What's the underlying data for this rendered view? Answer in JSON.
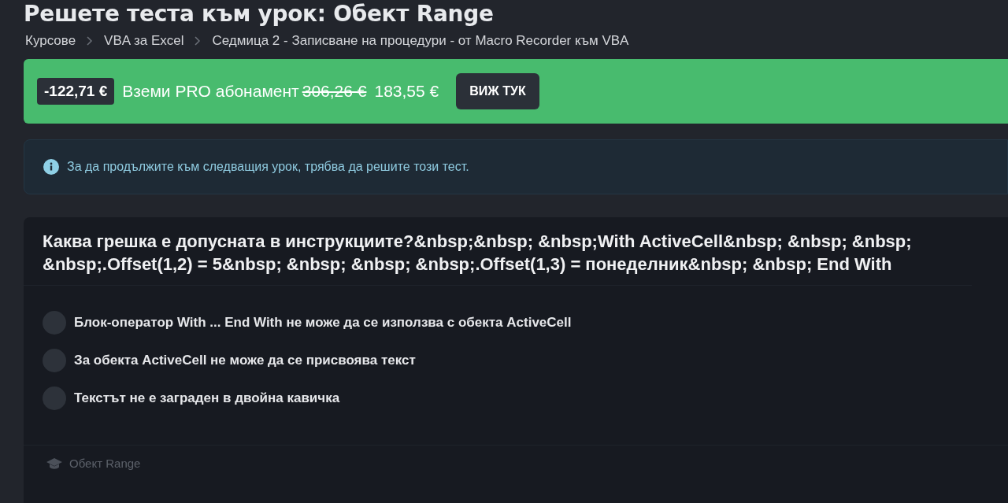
{
  "title": "Решете теста към урок: Обект Range",
  "breadcrumb": [
    "Курсове",
    "VBA за Excel",
    "Седмица 2 - Записване на  процедури - от Macro Recorder към VBA"
  ],
  "promo": {
    "discount": "-122,71 €",
    "text": "Вземи PRO абонамент",
    "old_price": "306,26 €",
    "price": "183,55 €",
    "button": "ВИЖ ТУК"
  },
  "notice": "За да продължите към следващия урок, трябва да решите този тест.",
  "question": "Каква грешка е допусната в инструкциите?&nbsp;&nbsp; &nbsp;With ActiveCell&nbsp; &nbsp; &nbsp; &nbsp;.Offset(1,2) = 5&nbsp; &nbsp; &nbsp; &nbsp;.Offset(1,3) = понеделник&nbsp; &nbsp; End With",
  "options": [
    {
      "label": "Блок-оператор With ... End With не може да се използва с обекта ActiveCell",
      "selected": false
    },
    {
      "label": "За обекта ActiveCell не може да се присвоява текст",
      "selected": false
    },
    {
      "label": "Текстът не е заграден в двойна кавичка",
      "selected": false
    }
  ],
  "footer": "Обект Range"
}
